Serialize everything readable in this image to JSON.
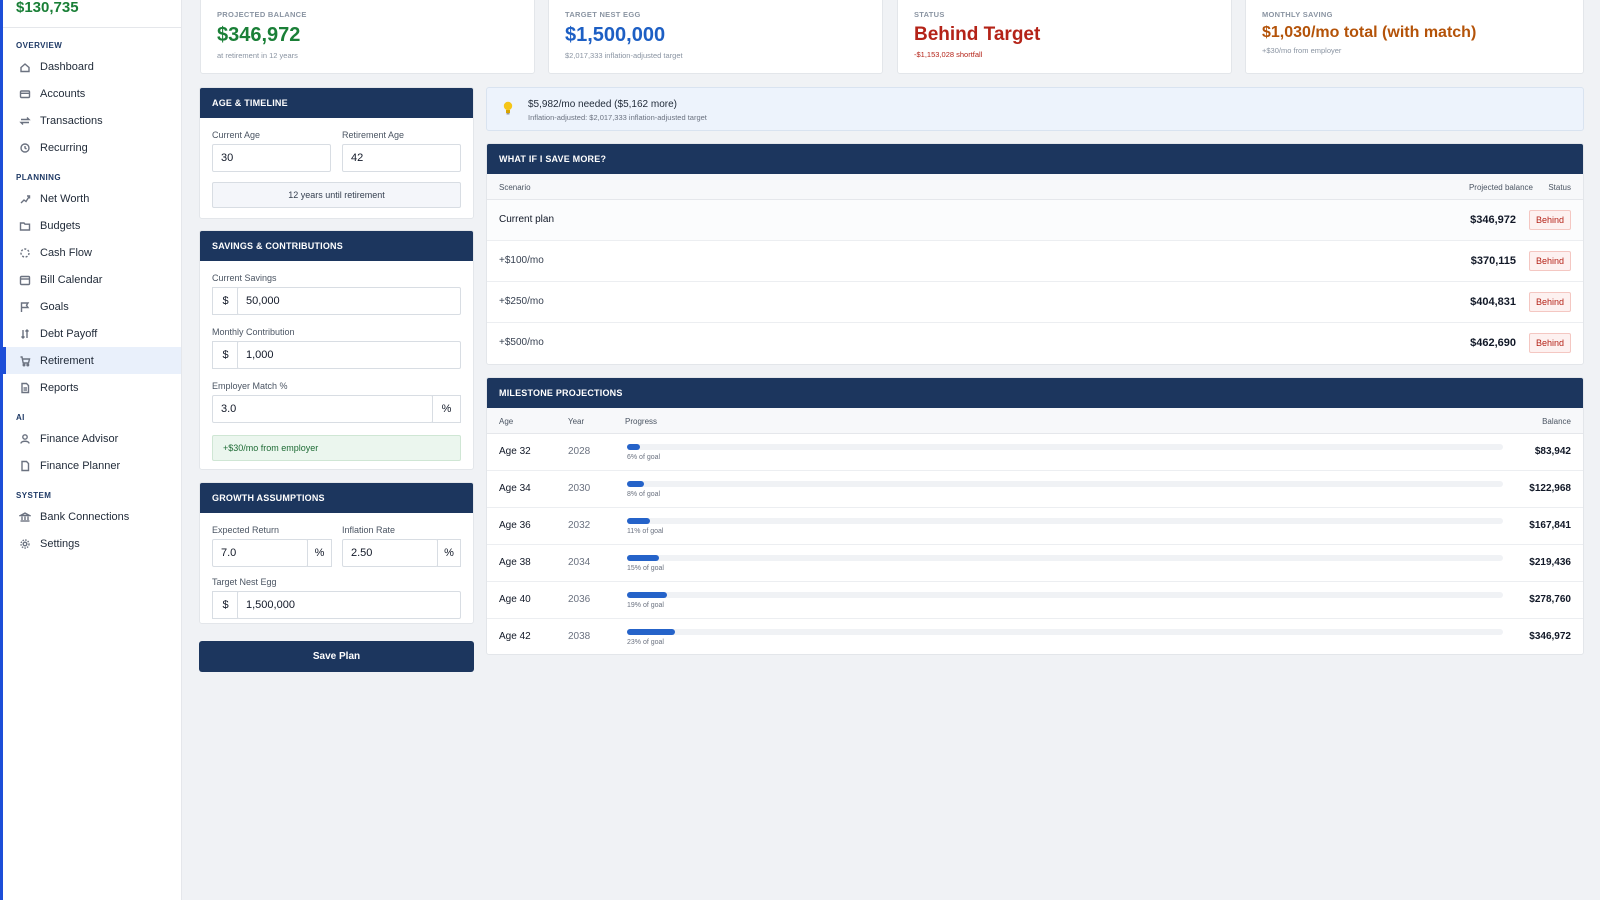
{
  "sidebar": {
    "net_worth": "$130,735",
    "sections": [
      {
        "label": "OVERVIEW",
        "items": [
          {
            "label": "Dashboard",
            "icon": "home-icon"
          },
          {
            "label": "Accounts",
            "icon": "credit-card-icon"
          },
          {
            "label": "Transactions",
            "icon": "swap-arrows-icon"
          },
          {
            "label": "Recurring",
            "icon": "repeat-icon"
          }
        ]
      },
      {
        "label": "PLANNING",
        "items": [
          {
            "label": "Net Worth",
            "icon": "trend-icon"
          },
          {
            "label": "Budgets",
            "icon": "folder-icon"
          },
          {
            "label": "Cash Flow",
            "icon": "loader-icon"
          },
          {
            "label": "Bill Calendar",
            "icon": "calendar-icon"
          },
          {
            "label": "Goals",
            "icon": "flag-icon"
          },
          {
            "label": "Debt Payoff",
            "icon": "sort-arrows-icon"
          },
          {
            "label": "Retirement",
            "icon": "cart-icon",
            "active": true
          },
          {
            "label": "Reports",
            "icon": "document-icon"
          }
        ]
      },
      {
        "label": "AI",
        "items": [
          {
            "label": "Finance Advisor",
            "icon": "user-icon"
          },
          {
            "label": "Finance Planner",
            "icon": "file-icon"
          }
        ]
      },
      {
        "label": "SYSTEM",
        "items": [
          {
            "label": "Bank Connections",
            "icon": "bank-icon"
          },
          {
            "label": "Settings",
            "icon": "gear-icon"
          }
        ]
      }
    ]
  },
  "stats": [
    {
      "label": "PROJECTED BALANCE",
      "value": "$346,972",
      "sub": "at retirement in 12 years",
      "color": "#1a7f37"
    },
    {
      "label": "TARGET NEST EGG",
      "value": "$1,500,000",
      "sub": "$2,017,333 inflation-adjusted target",
      "color": "#1d5fc4"
    },
    {
      "label": "STATUS",
      "value": "Behind Target",
      "sub": "-$1,153,028 shortfall",
      "color": "#b42318",
      "sub_color": "#b42318"
    },
    {
      "label": "MONTHLY SAVING",
      "value": "$1,030/mo total (with match)",
      "sub": "+$30/mo from employer",
      "color": "#b45309"
    }
  ],
  "age_panel": {
    "title": "AGE & TIMELINE",
    "current_age_label": "Current Age",
    "current_age": "30",
    "retirement_age_label": "Retirement Age",
    "retirement_age": "42",
    "years_note": "12 years until retirement"
  },
  "savings_panel": {
    "title": "SAVINGS & CONTRIBUTIONS",
    "current_savings_label": "Current Savings",
    "current_savings": "50,000",
    "monthly_label": "Monthly Contribution",
    "monthly": "1,000",
    "match_label": "Employer Match %",
    "match": "3.0",
    "currency": "$",
    "percent": "%",
    "match_note": "+$30/mo from employer"
  },
  "growth_panel": {
    "title": "GROWTH ASSUMPTIONS",
    "return_label": "Expected Return",
    "return": "7.0",
    "inflation_label": "Inflation Rate",
    "inflation": "2.50",
    "target_label": "Target Nest Egg",
    "target": "1,500,000"
  },
  "save_button": "Save Plan",
  "tip": {
    "line1": "$5,982/mo needed ($5,162 more)",
    "line2": "Inflation-adjusted: $2,017,333 inflation-adjusted target"
  },
  "scenarios": {
    "title": "WHAT IF I SAVE MORE?",
    "headers": {
      "scenario": "Scenario",
      "balance": "Projected balance",
      "status": "Status"
    },
    "rows": [
      {
        "scenario": "Current plan",
        "balance": "$346,972",
        "status": "Behind"
      },
      {
        "scenario": "+$100/mo",
        "balance": "$370,115",
        "status": "Behind"
      },
      {
        "scenario": "+$250/mo",
        "balance": "$404,831",
        "status": "Behind"
      },
      {
        "scenario": "+$500/mo",
        "balance": "$462,690",
        "status": "Behind"
      }
    ]
  },
  "milestones": {
    "title": "MILESTONE PROJECTIONS",
    "headers": {
      "age": "Age",
      "year": "Year",
      "progress": "Progress",
      "balance": "Balance"
    },
    "rows": [
      {
        "age": "Age 32",
        "year": "2028",
        "progress_pct": 6,
        "progress_label": "6% of goal",
        "balance": "$83,942"
      },
      {
        "age": "Age 34",
        "year": "2030",
        "progress_pct": 8,
        "progress_label": "8% of goal",
        "balance": "$122,968"
      },
      {
        "age": "Age 36",
        "year": "2032",
        "progress_pct": 11,
        "progress_label": "11% of goal",
        "balance": "$167,841"
      },
      {
        "age": "Age 38",
        "year": "2034",
        "progress_pct": 15,
        "progress_label": "15% of goal",
        "balance": "$219,436"
      },
      {
        "age": "Age 40",
        "year": "2036",
        "progress_pct": 19,
        "progress_label": "19% of goal",
        "balance": "$278,760"
      },
      {
        "age": "Age 42",
        "year": "2038",
        "progress_pct": 23,
        "progress_label": "23% of goal",
        "balance": "$346,972"
      }
    ]
  }
}
